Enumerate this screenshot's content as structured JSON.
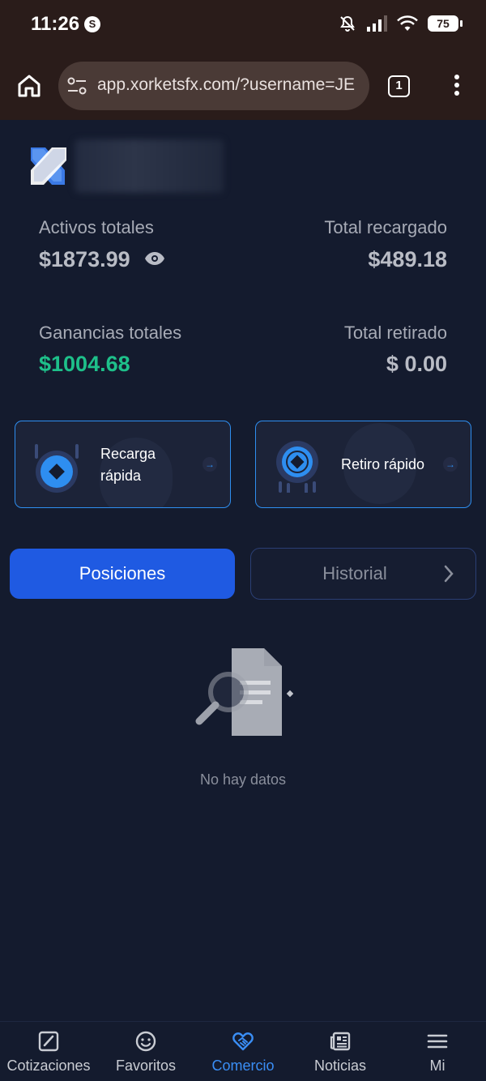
{
  "status_bar": {
    "time": "11:26",
    "s_badge": "S",
    "battery": "75"
  },
  "browser": {
    "url": "app.xorketsfx.com/?username=JE",
    "tab_count": "1"
  },
  "stats": {
    "total_assets_label": "Activos totales",
    "total_assets_value": "$1873.99",
    "total_recharged_label": "Total recargado",
    "total_recharged_value": "$489.18",
    "total_profit_label": "Ganancias totales",
    "total_profit_value": "$1004.68",
    "total_withdrawn_label": "Total retirado",
    "total_withdrawn_value": "$ 0.00"
  },
  "actions": {
    "recharge_line1": "Recarga",
    "recharge_line2": "rápida",
    "withdraw": "Retiro rápido"
  },
  "tabs": {
    "positions": "Posiciones",
    "history": "Historial"
  },
  "empty_state": {
    "text": "No hay datos"
  },
  "bottom_nav": [
    {
      "label": "Cotizaciones",
      "icon": "chart-icon"
    },
    {
      "label": "Favoritos",
      "icon": "smiley-icon"
    },
    {
      "label": "Comercio",
      "icon": "handshake-icon",
      "active": true
    },
    {
      "label": "Noticias",
      "icon": "news-icon"
    },
    {
      "label": "Mi",
      "icon": "menu-icon"
    }
  ],
  "colors": {
    "accent": "#2e8ef0",
    "active_tab": "#1f5ae2",
    "profit": "#1ec08a",
    "background": "#141b2e"
  }
}
